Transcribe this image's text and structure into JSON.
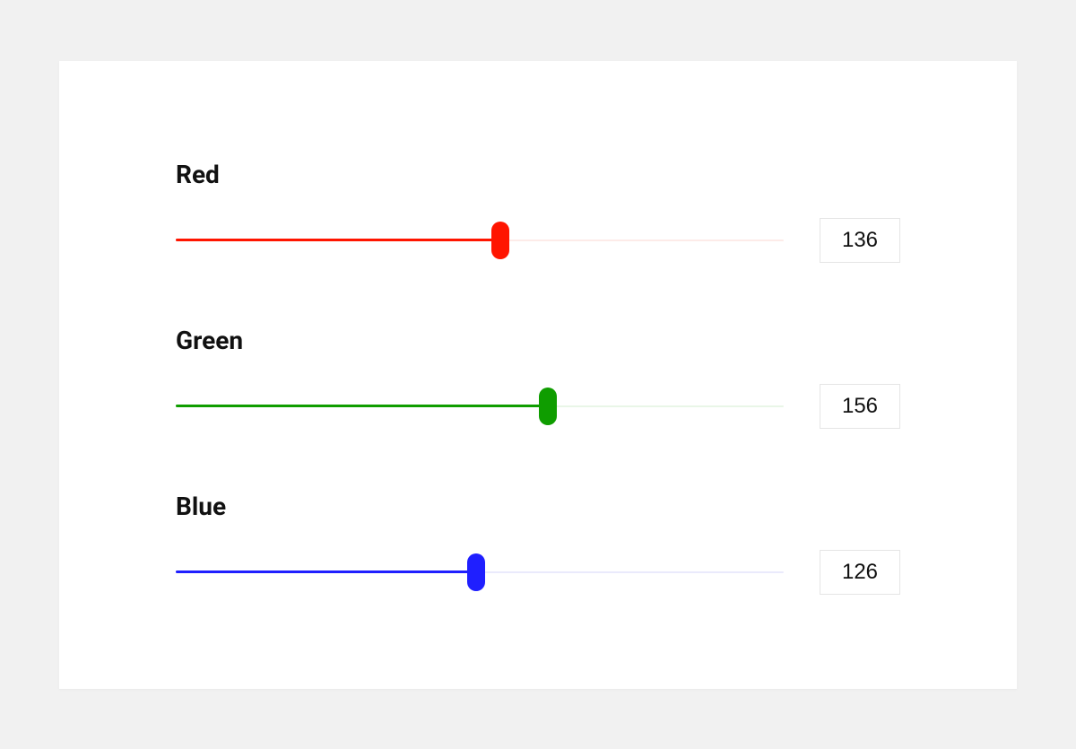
{
  "range": {
    "min": 0,
    "max": 255
  },
  "sliders": [
    {
      "id": "red",
      "label": "Red",
      "value": 136,
      "fill_color": "#ff1500",
      "thumb_color": "#ff1500",
      "track_bg_color": "#fdebe8"
    },
    {
      "id": "green",
      "label": "Green",
      "value": 156,
      "fill_color": "#0f9d00",
      "thumb_color": "#0f9d00",
      "track_bg_color": "#e9f6e7"
    },
    {
      "id": "blue",
      "label": "Blue",
      "value": 126,
      "fill_color": "#1f1fff",
      "thumb_color": "#1f1fff",
      "track_bg_color": "#eaeafc"
    }
  ]
}
